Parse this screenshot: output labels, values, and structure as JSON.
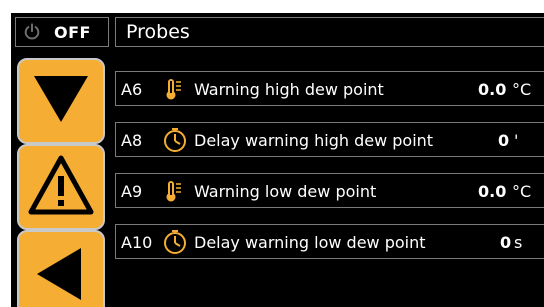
{
  "status": {
    "power_label": "OFF"
  },
  "header": {
    "title": "Probes"
  },
  "sidebar": {
    "buttons": [
      {
        "icon": "arrow-down-icon"
      },
      {
        "icon": "warning-icon"
      },
      {
        "icon": "arrow-left-icon"
      }
    ]
  },
  "params": [
    {
      "code": "A6",
      "icon": "thermometer-icon",
      "label": "Warning high dew point",
      "value": "0.0",
      "unit": "°C"
    },
    {
      "code": "A8",
      "icon": "timer-icon",
      "label": "Delay warning high dew point",
      "value": "0",
      "unit": "'"
    },
    {
      "code": "A9",
      "icon": "thermometer-icon",
      "label": "Warning low dew point",
      "value": "0.0",
      "unit": "°C"
    },
    {
      "code": "A10",
      "icon": "timer-icon",
      "label": "Delay warning low dew point",
      "value": "0",
      "unit": "s"
    }
  ],
  "colors": {
    "accent": "#f5ad33",
    "background": "#000000",
    "border": "#7a7a7a",
    "power_icon": "#6e6e6e"
  }
}
